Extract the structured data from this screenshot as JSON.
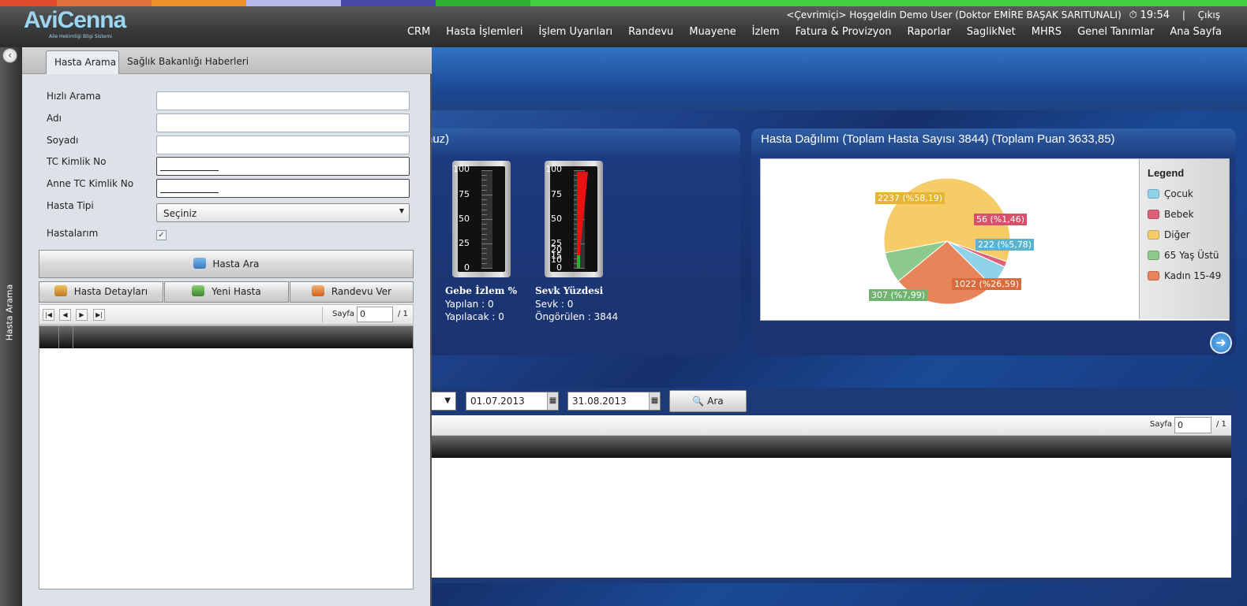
{
  "colors": {
    "strip": [
      "#e04a2a",
      "#e0703a",
      "#f0902a",
      "#b8b8e8",
      "#4848a8",
      "#30b030",
      "#40d040"
    ],
    "pie": {
      "cocuk": "#8fd3e8",
      "bebek": "#e0607a",
      "diger": "#f6cc68",
      "yas65": "#8cc98c",
      "kadin": "#e8845a"
    }
  },
  "header": {
    "logo": "AviCenna",
    "logo_sub": "Aile Hekimliği Bilgi Sistemi",
    "welcome": "<Çevrimiçi> Hoşgeldin Demo User (Doktor EMİRE BAŞAK SARITUNALI)",
    "time": "19:54",
    "separator": "|",
    "logout": "Çıkış",
    "clock_icon": "stopwatch-icon",
    "nav": [
      "CRM",
      "Hasta İşlemleri",
      "İşlem Uyarıları",
      "Randevu",
      "Muayene",
      "İzlem",
      "Fatura & Provizyon",
      "Raporlar",
      "SaglikNet",
      "MHRS",
      "Genel Tanımlar",
      "Ana Sayfa"
    ]
  },
  "sidebar": {
    "label": "Hasta Arama",
    "collapse_icon": "chevron-left-icon"
  },
  "search_panel": {
    "tabs": [
      "Hasta Arama",
      "Sağlık Bakanlığı Haberleri"
    ],
    "labels": {
      "hizli": "Hızlı Arama",
      "adi": "Adı",
      "soyadi": "Soyadı",
      "tc": "TC Kimlik No",
      "anne_tc": "Anne TC Kimlik No",
      "tipi": "Hasta Tipi",
      "hastalarim": "Hastalarım"
    },
    "tipi_value": "Seçiniz",
    "hastalarim_checked": true,
    "buttons": {
      "ara": "Hasta Ara",
      "detay": "Hasta Detayları",
      "yeni": "Yeni Hasta",
      "randevu": "Randevu Ver"
    },
    "pager": {
      "label": "Sayfa",
      "page": "0",
      "total": "/ 1"
    }
  },
  "panel1": {
    "title_fragment": "nuz)",
    "gauges": [
      {
        "title": "Gebe İzlem %",
        "lines": [
          "Yapılan : 0",
          "Yapılacak : 0"
        ],
        "ticks": [
          "100",
          "75",
          "50",
          "25",
          "0"
        ],
        "value": 0
      },
      {
        "title": "Sevk Yüzdesi",
        "lines": [
          "Sevk : 0",
          "Öngörülen : 3844"
        ],
        "ticks": [
          "100",
          "75",
          "50",
          "25",
          "20",
          "15",
          "10",
          "0"
        ],
        "value": 0
      }
    ]
  },
  "panel2": {
    "title": "Hasta Dağılımı (Toplam Hasta Sayısı 3844) (Toplam Puan 3633,85)"
  },
  "chart_data": {
    "type": "pie",
    "title": "Hasta Dağılımı (Toplam Hasta Sayısı 3844) (Toplam Puan 3633,85)",
    "legend_title": "Legend",
    "legend_position": "right",
    "slices": [
      {
        "name": "Çocuk",
        "value": 222,
        "label": "222 (%5,78)",
        "color": "#8fd3e8"
      },
      {
        "name": "Bebek",
        "value": 56,
        "label": "56 (%1,46)",
        "color": "#e0607a"
      },
      {
        "name": "Diğer",
        "value": 2237,
        "label": "2237 (%58,19)",
        "color": "#f6cc68"
      },
      {
        "name": "65 Yaş Üstü",
        "value": 307,
        "label": "307 (%7,99)",
        "color": "#8cc98c"
      },
      {
        "name": "Kadın 15-49",
        "value": 1022,
        "label": "1022 (%26,59)",
        "color": "#e8845a"
      }
    ]
  },
  "lower": {
    "date_from": "01.07.2013",
    "date_to": "31.08.2013",
    "search": "Ara",
    "pager": {
      "label": "Sayfa",
      "page": "0",
      "total": "/ 1"
    }
  }
}
